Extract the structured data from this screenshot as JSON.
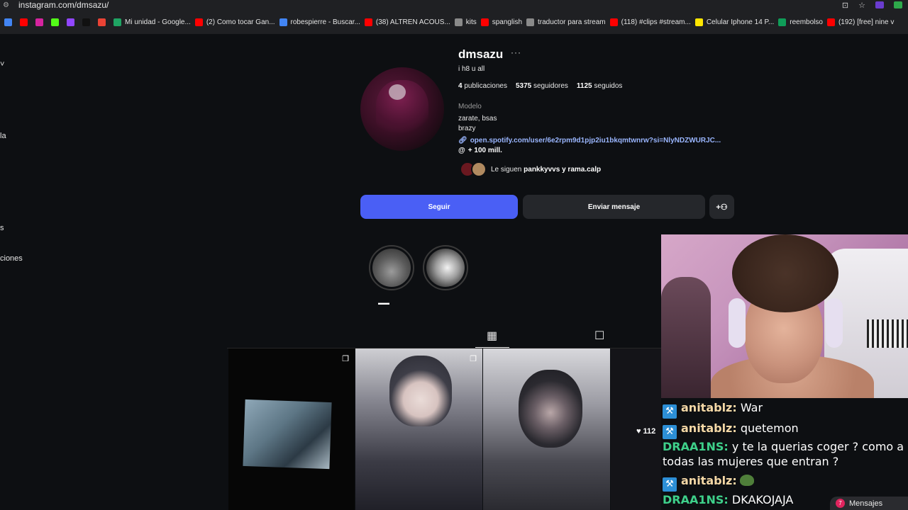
{
  "browser": {
    "url": "instagram.com/dmsazu/",
    "bookmarks": [
      {
        "label": "",
        "icon": "google-icon",
        "color": "#4285f4"
      },
      {
        "label": "",
        "icon": "youtube-icon",
        "color": "#ff0000"
      },
      {
        "label": "",
        "icon": "instagram-icon",
        "color": "#d6249f"
      },
      {
        "label": "",
        "icon": "kick-icon",
        "color": "#53fc18"
      },
      {
        "label": "",
        "icon": "twitch-icon",
        "color": "#9146ff"
      },
      {
        "label": "",
        "icon": "tiktok-icon",
        "color": "#111111"
      },
      {
        "label": "",
        "icon": "gmail-icon",
        "color": "#ea4335"
      },
      {
        "label": "Mi unidad - Google...",
        "icon": "drive-icon",
        "color": "#1fa463"
      },
      {
        "label": "(2) Como tocar Gan...",
        "icon": "youtube-icon",
        "color": "#ff0000"
      },
      {
        "label": "robespierre - Buscar...",
        "icon": "google-icon",
        "color": "#4285f4"
      },
      {
        "label": "(38) ALTREN ACOUS...",
        "icon": "youtube-icon",
        "color": "#ff0000"
      },
      {
        "label": "kits",
        "icon": "folder-icon",
        "color": "#8a8a8a"
      },
      {
        "label": "spanglish",
        "icon": "youtube-icon",
        "color": "#ff0000"
      },
      {
        "label": "traductor para stream",
        "icon": "globe-icon",
        "color": "#8a8a8a"
      },
      {
        "label": "(118) #clips #stream...",
        "icon": "youtube-icon",
        "color": "#ff0000"
      },
      {
        "label": "Celular Iphone 14 P...",
        "icon": "mercadolibre-icon",
        "color": "#ffe600"
      },
      {
        "label": "reembolso",
        "icon": "sheets-icon",
        "color": "#0f9d58"
      },
      {
        "label": "(192) [free] nine v",
        "icon": "youtube-icon",
        "color": "#ff0000"
      }
    ]
  },
  "sidebar": {
    "fragments": [
      "la",
      "s",
      "ciones"
    ]
  },
  "profile": {
    "username": "dmsazu",
    "more": "···",
    "full_name": "i h8 u all",
    "posts_count": "4",
    "posts_label": "publicaciones",
    "followers_count": "5375",
    "followers_label": "seguidores",
    "following_count": "1125",
    "following_label": "seguidos",
    "category": "Modelo",
    "bio_line1": "zarate, bsas",
    "bio_line2": "brazy",
    "link": "open.spotify.com/user/6e2rpm9d1pjp2iu1bkqmtwnrw?si=NlyNDZWURJC...",
    "threads": "+ 100 mill.",
    "followed_by_prefix": "Le siguen ",
    "followed_by_names": "pankkyvvs y rama.calp",
    "follow_button": "Seguir",
    "message_button": "Enviar mensaje",
    "highlight_label": "▬▬"
  },
  "grid": {
    "likes": "112"
  },
  "chat": [
    {
      "user": "anitablz",
      "text": " War",
      "badge": true,
      "user_color": "#f4d8a6"
    },
    {
      "user": "anitablz",
      "text": " quetemon",
      "badge": true,
      "user_color": "#f4d8a6"
    },
    {
      "user": "DRAA1NS",
      "text": " y te la querias coger ? como a",
      "badge": false,
      "user_color": "#3ed08a"
    },
    {
      "user": "",
      "text": "todas las mujeres que entran ?",
      "badge": false,
      "user_color": "#3ed08a"
    },
    {
      "user": "anitablz",
      "text": "",
      "badge": true,
      "user_color": "#f4d8a6",
      "emote": true
    },
    {
      "user": "DRAA1NS",
      "text": " DKAKOJAJA",
      "badge": false,
      "user_color": "#3ed08a"
    }
  ],
  "messages_pill": {
    "count": "7",
    "label": "Mensajes"
  }
}
